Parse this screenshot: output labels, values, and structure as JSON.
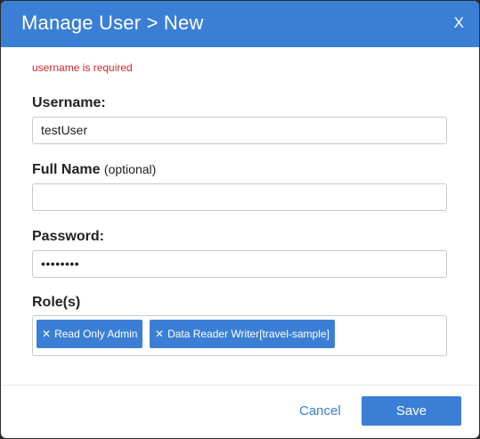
{
  "dialog": {
    "title": "Manage User > New",
    "close_label": "X",
    "error_message": "username is required"
  },
  "form": {
    "username": {
      "label": "Username:",
      "value": "testUser"
    },
    "full_name": {
      "label": "Full Name",
      "optional_note": "(optional)",
      "value": ""
    },
    "password": {
      "label": "Password:",
      "value": "••••••••"
    },
    "roles": {
      "label": "Role(s)",
      "remove_glyph": "✕",
      "items": [
        {
          "label": "Read Only Admin"
        },
        {
          "label": "Data Reader Writer[travel-sample]"
        }
      ]
    }
  },
  "footer": {
    "cancel_label": "Cancel",
    "save_label": "Save"
  },
  "colors": {
    "accent": "#3a7fd5",
    "error": "#d0282d"
  }
}
